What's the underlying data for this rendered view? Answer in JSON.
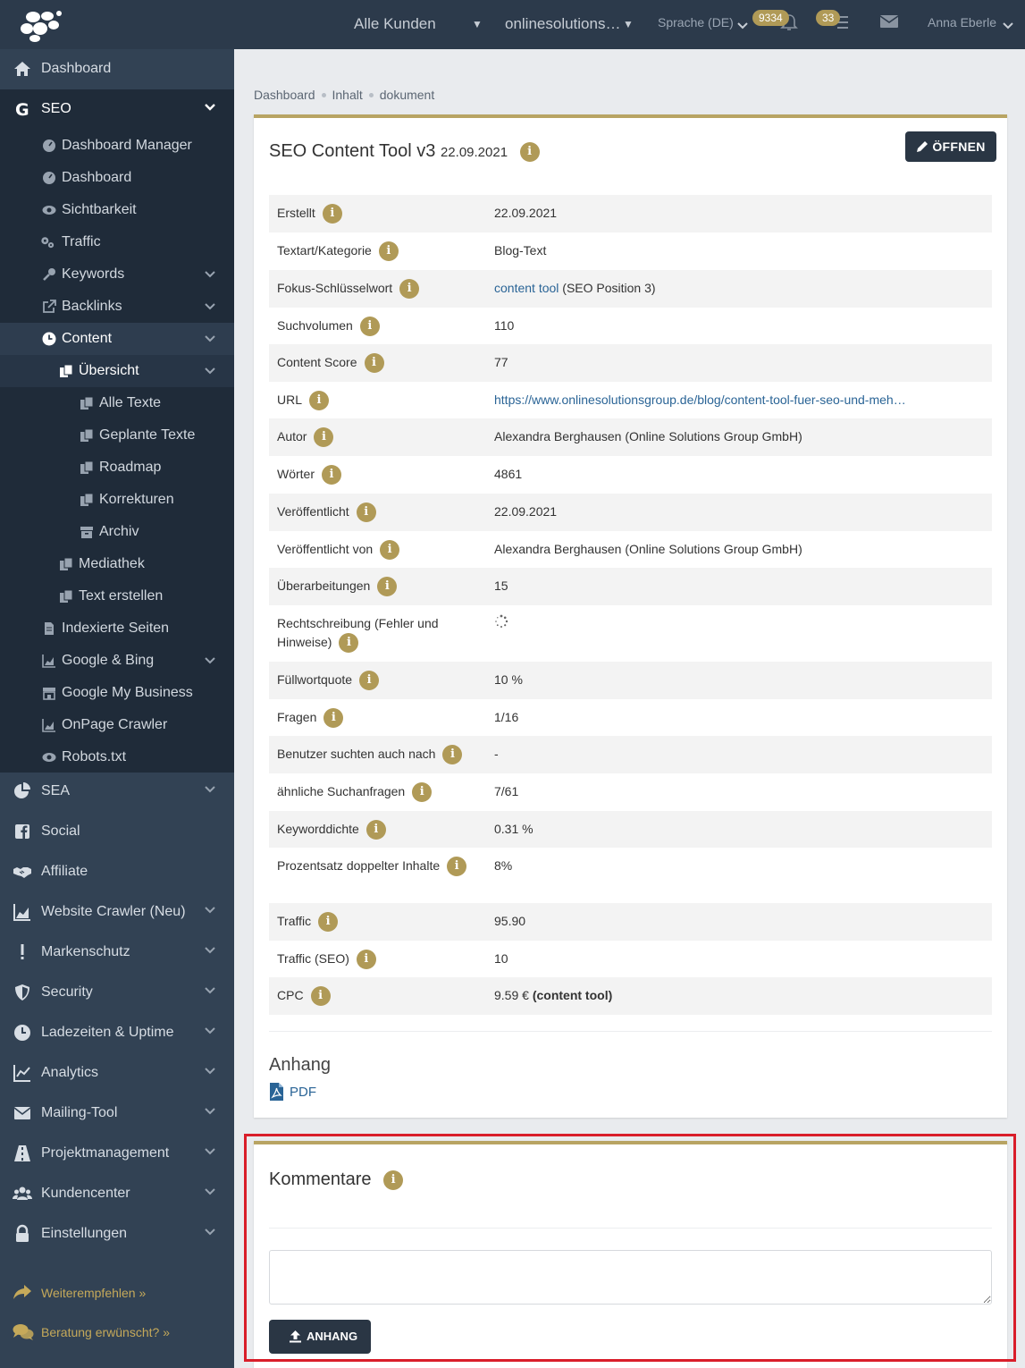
{
  "topbar": {
    "customer_select": "Alle Kunden",
    "project_select": "onlinesolutions…",
    "language": "Sprache (DE)",
    "notifications_count": "9334",
    "tasks_count": "33",
    "user_name": "Anna Eberle"
  },
  "sidebar": {
    "items": [
      {
        "label": "Dashboard",
        "icon": "home-icon"
      },
      {
        "label": "SEO",
        "icon": "google-icon"
      },
      {
        "label": "SEA",
        "icon": "pie-chart-icon"
      },
      {
        "label": "Social",
        "icon": "facebook-icon"
      },
      {
        "label": "Affiliate",
        "icon": "handshake-icon"
      },
      {
        "label": "Website Crawler (Neu)",
        "icon": "area-chart-icon"
      },
      {
        "label": "Markenschutz",
        "icon": "exclamation-icon"
      },
      {
        "label": "Security",
        "icon": "shield-icon"
      },
      {
        "label": "Ladezeiten & Uptime",
        "icon": "clock-icon"
      },
      {
        "label": "Analytics",
        "icon": "line-chart-icon"
      },
      {
        "label": "Mailing-Tool",
        "icon": "envelope-icon"
      },
      {
        "label": "Projektmanagement",
        "icon": "road-icon"
      },
      {
        "label": "Kundencenter",
        "icon": "users-icon"
      },
      {
        "label": "Einstellungen",
        "icon": "lock-icon"
      }
    ],
    "seo_sub": [
      {
        "label": "Dashboard Manager"
      },
      {
        "label": "Dashboard"
      },
      {
        "label": "Sichtbarkeit"
      },
      {
        "label": "Traffic"
      },
      {
        "label": "Keywords"
      },
      {
        "label": "Backlinks"
      },
      {
        "label": "Content"
      },
      {
        "label": "Übersicht"
      },
      {
        "label": "Alle Texte"
      },
      {
        "label": "Geplante Texte"
      },
      {
        "label": "Roadmap"
      },
      {
        "label": "Korrekturen"
      },
      {
        "label": "Archiv"
      },
      {
        "label": "Mediathek"
      },
      {
        "label": "Text erstellen"
      },
      {
        "label": "Indexierte Seiten"
      },
      {
        "label": "Google & Bing"
      },
      {
        "label": "Google My Business"
      },
      {
        "label": "OnPage Crawler"
      },
      {
        "label": "Robots.txt"
      }
    ],
    "recommend": "Weiterempfehlen »",
    "consulting": "Beratung erwünscht? »"
  },
  "breadcrumb": [
    "Dashboard",
    "Inhalt",
    "dokument"
  ],
  "document": {
    "title": "SEO Content Tool v3",
    "date": "22.09.2021",
    "open_button": "ÖFFNEN",
    "rows": [
      {
        "key": "Erstellt",
        "value": "22.09.2021"
      },
      {
        "key": "Textart/Kategorie",
        "value": "Blog-Text"
      },
      {
        "key": "Fokus-Schlüsselwort",
        "link": "content tool",
        "value": " (SEO Position 3)"
      },
      {
        "key": "Suchvolumen",
        "value": "110"
      },
      {
        "key": "Content Score",
        "value": "77"
      },
      {
        "key": "URL",
        "link": "https://www.onlinesolutionsgroup.de/blog/content-tool-fuer-seo-und-meh…"
      },
      {
        "key": "Autor",
        "value": "Alexandra Berghausen (Online Solutions Group GmbH)"
      },
      {
        "key": "Wörter",
        "value": "4861"
      },
      {
        "key": "Veröffentlicht",
        "value": "22.09.2021"
      },
      {
        "key": "Veröffentlicht von",
        "value": "Alexandra Berghausen (Online Solutions Group GmbH)"
      },
      {
        "key": "Überarbeitungen",
        "value": "15"
      },
      {
        "key": "Rechtschreibung (Fehler und Hinweise)",
        "value": ""
      },
      {
        "key": "Füllwortquote",
        "value": "10 %"
      },
      {
        "key": "Fragen",
        "value": "1/16"
      },
      {
        "key": "Benutzer suchten auch nach",
        "value": "-"
      },
      {
        "key": "ähnliche Suchanfragen",
        "value": "7/61"
      },
      {
        "key": "Keyworddichte",
        "value": "0.31 %"
      },
      {
        "key": "Prozentsatz doppelter Inhalte",
        "value": "8%"
      },
      {
        "key": "Traffic",
        "value": "95.90"
      },
      {
        "key": "Traffic (SEO)",
        "value": "10"
      },
      {
        "key": "CPC",
        "value": "9.59 € ",
        "bold": "(content tool)"
      }
    ],
    "attachment_title": "Anhang",
    "pdf_label": "PDF"
  },
  "comments": {
    "title": "Kommentare",
    "input_value": "",
    "upload_button": "ANHANG"
  },
  "colors": {
    "sidebar_bg": "#324254",
    "sidebar_sub_bg": "#1f2b39",
    "accent_gold": "#b09a57",
    "button_dark": "#2a3644",
    "link_blue": "#2a6496",
    "highlight_red": "#d91e2a"
  }
}
